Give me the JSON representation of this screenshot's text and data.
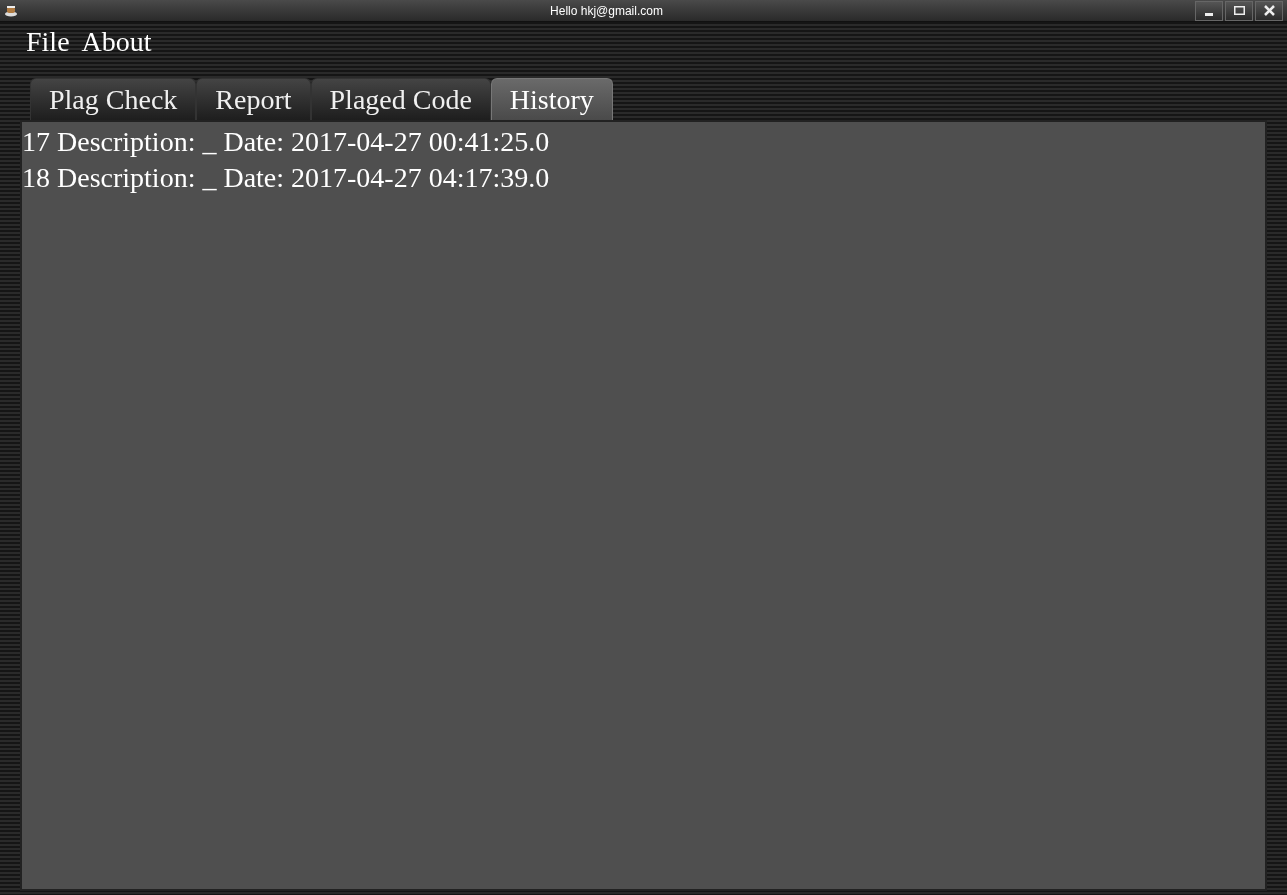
{
  "window": {
    "title": "Hello hkj@gmail.com"
  },
  "menu": [
    "File",
    "About"
  ],
  "tabs": [
    {
      "label": "Plag Check",
      "selected": false
    },
    {
      "label": "Report",
      "selected": false
    },
    {
      "label": "Plaged Code",
      "selected": false
    },
    {
      "label": "History",
      "selected": true
    }
  ],
  "history": [
    "17 Description: _ Date: 2017-04-27 00:41:25.0",
    "18 Description: _ Date: 2017-04-27 04:17:39.0"
  ]
}
